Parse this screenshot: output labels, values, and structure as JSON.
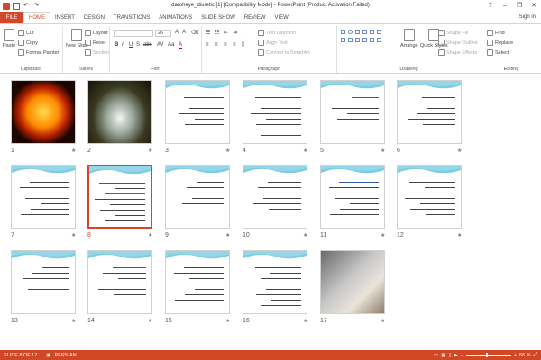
{
  "window": {
    "title": "darohaye_diuretic [1] [Compatibility Mode] - PowerPoint (Product Activation Failed)",
    "sign_in": "Sign in"
  },
  "tabs": [
    "FILE",
    "HOME",
    "INSERT",
    "DESIGN",
    "TRANSITIONS",
    "ANIMATIONS",
    "SLIDE SHOW",
    "REVIEW",
    "VIEW"
  ],
  "active_tab": "HOME",
  "ribbon": {
    "clipboard": {
      "label": "Clipboard",
      "paste": "Paste",
      "cut": "Cut",
      "copy": "Copy",
      "format_painter": "Format Painter"
    },
    "slides": {
      "label": "Slides",
      "new_slide": "New Slide",
      "layout": "Layout",
      "reset": "Reset",
      "section": "Section"
    },
    "font": {
      "label": "Font",
      "size": "26",
      "bold": "B",
      "italic": "I",
      "underline": "U",
      "strike": "S",
      "shadow": "abc",
      "spacing": "AV",
      "case": "Aa",
      "color": "A"
    },
    "paragraph": {
      "label": "Paragraph",
      "text_direction": "Text Direction",
      "align_text": "Align Text",
      "smartart": "Convert to SmartArt"
    },
    "drawing": {
      "label": "Drawing",
      "arrange": "Arrange",
      "quick_styles": "Quick Styles",
      "shape_fill": "Shape Fill",
      "shape_outline": "Shape Outline",
      "shape_effects": "Shape Effects"
    },
    "editing": {
      "label": "Editing",
      "find": "Find",
      "replace": "Replace",
      "select": "Select"
    }
  },
  "slides": [
    {
      "num": "1",
      "star": "★"
    },
    {
      "num": "2",
      "star": "★"
    },
    {
      "num": "3",
      "star": "★"
    },
    {
      "num": "4",
      "star": "★"
    },
    {
      "num": "5",
      "star": "★"
    },
    {
      "num": "6",
      "star": "★"
    },
    {
      "num": "7",
      "star": "★"
    },
    {
      "num": "8",
      "star": "★"
    },
    {
      "num": "9",
      "star": "★"
    },
    {
      "num": "10",
      "star": "★"
    },
    {
      "num": "11",
      "star": "★"
    },
    {
      "num": "12",
      "star": "★"
    },
    {
      "num": "13",
      "star": "★"
    },
    {
      "num": "14",
      "star": "★"
    },
    {
      "num": "15",
      "star": "★"
    },
    {
      "num": "16",
      "star": "★"
    },
    {
      "num": "17",
      "star": "★"
    }
  ],
  "selected_slide": 8,
  "status": {
    "slide_info": "SLIDE 8 OF 17",
    "language": "PERSIAN",
    "zoom": "66 %"
  },
  "colors": {
    "accent": "#d24726",
    "wave": "#5bc0d8"
  }
}
